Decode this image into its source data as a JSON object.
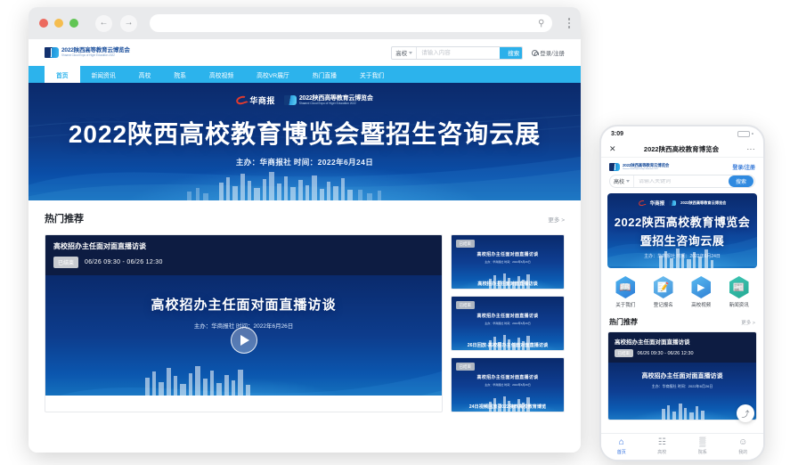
{
  "browser": {
    "traffic_lights": [
      "close",
      "minimize",
      "zoom"
    ],
    "back_glyph": "←",
    "forward_glyph": "→",
    "url_value": "",
    "search_icon": "search-icon",
    "menu_icon": "kebab-menu-icon"
  },
  "site": {
    "logo": {
      "cn": "2022陕西高等教育云博览会",
      "en": "Shaanxi Cloud Expo of Higer Education 2022"
    },
    "search": {
      "category": "高校",
      "placeholder": "请输入内容",
      "button": "搜索"
    },
    "login": "登录/注册",
    "nav": [
      {
        "label": "首页",
        "active": true
      },
      {
        "label": "新闻资讯",
        "active": false
      },
      {
        "label": "高校",
        "active": false
      },
      {
        "label": "院系",
        "active": false
      },
      {
        "label": "高校视频",
        "active": false
      },
      {
        "label": "高校VR展厅",
        "active": false
      },
      {
        "label": "热门直播",
        "active": false
      },
      {
        "label": "关于我们",
        "active": false
      }
    ]
  },
  "hero": {
    "partner_logo": "华商报",
    "expo_cn": "2022陕西高等教育云博览会",
    "expo_en": "Shaanxi Cloud Expo of Higer Education 2022",
    "title": "2022陕西高校教育博览会暨招生咨询云展",
    "subtitle": "主办：华商报社  时间：2022年6月24日"
  },
  "recommend": {
    "title": "热门推荐",
    "more": "更多 >",
    "feature": {
      "title": "高校招办主任面对面直播访谈",
      "badge": "已结束",
      "time": "06/26 09:30 - 06/26 12:30",
      "video_title": "高校招办主任面对面直播访谈",
      "video_sub": "主办：华商报社   时间：2022年6月26日",
      "play_icon": "play-icon"
    },
    "cards": [
      {
        "badge": "已结束",
        "inner_title": "高校招办主任面对面直播访谈",
        "inner_sub": "主办：华商报社  时间：2022年6月26日",
        "caption": "高校招办主任面对面直播访谈"
      },
      {
        "badge": "已结束",
        "inner_title": "高校招办主任面对面直播访谈",
        "inner_sub": "主办：华商报社  时间：2022年6月26日",
        "caption": "26日回放-高校招办主任面对面直播访谈"
      },
      {
        "badge": "已结束",
        "inner_title": "高校招办主任面对面直播访谈",
        "inner_sub": "主办：华商报社  时间：2022年6月26日",
        "caption": "24日视频回放-2022陕西高校教育博览"
      }
    ]
  },
  "phone": {
    "status": {
      "time": "3:09",
      "battery_icon": "battery-icon",
      "battery_cap": "•"
    },
    "titlebar": {
      "close_glyph": "✕",
      "title": "2022陕西高校教育博览会",
      "menu_glyph": "···"
    },
    "login": "登录/注册",
    "search": {
      "category": "高校",
      "placeholder": "请输入关键词",
      "button": "搜索"
    },
    "banner": {
      "partner_logo": "华商报",
      "expo_cn": "2022陕西高等教育云博览会",
      "title_line1": "2022陕西高校教育博览会",
      "title_line2": "暨招生咨询云展",
      "subtitle": "主办：华商报社  时间：2022年6月24日"
    },
    "quick_icons": [
      {
        "label": "关于我们",
        "icon": "book-icon",
        "glyph": "📖"
      },
      {
        "label": "登记报名",
        "icon": "form-pen-icon",
        "glyph": "📝"
      },
      {
        "label": "高校视频",
        "icon": "video-play-icon",
        "glyph": "▶"
      },
      {
        "label": "新闻资讯",
        "icon": "news-icon",
        "glyph": "📰"
      }
    ],
    "recommend": {
      "title": "热门推荐",
      "more": "更多 >",
      "card": {
        "title": "高校招办主任面对面直播访谈",
        "badge": "已结束",
        "time": "06/26 09:30 - 06/26 12:30",
        "video_title": "高校招办主任面对面直播访谈",
        "video_sub": "主办：华商报社   时间：2022年6月26日"
      }
    },
    "fab_icon": "scroll-to-top-icon",
    "fab_glyph": "⤴",
    "tabs": [
      {
        "label": "首页",
        "glyph": "⌂",
        "active": true
      },
      {
        "label": "高校",
        "glyph": "☷",
        "active": false
      },
      {
        "label": "院系",
        "glyph": "▒",
        "active": false
      },
      {
        "label": "我的",
        "glyph": "☺",
        "active": false
      }
    ]
  },
  "colors": {
    "accent_blue": "#2cb3ec",
    "nav_blue": "#2cb3ec",
    "deep_navy": "#0d1c42",
    "badge_grey": "#c9ccd1",
    "phone_tab_active": "#2f6fe0"
  }
}
